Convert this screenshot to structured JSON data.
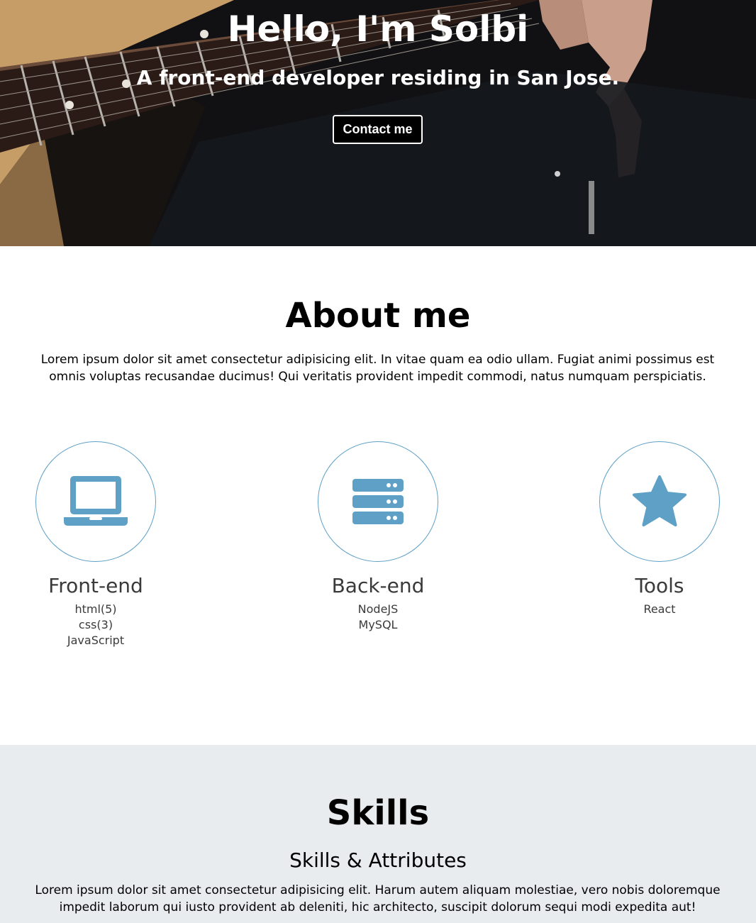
{
  "hero": {
    "title": "Hello, I'm Solbi",
    "subtitle": "A front-end developer residing in San Jose.",
    "contact_label": "Contact me"
  },
  "about": {
    "title": "About me",
    "text": "Lorem ipsum dolor sit amet consectetur adipisicing elit. In vitae quam ea odio ullam. Fugiat animi possimus est omnis voluptas recusandae ducimus! Qui veritatis provident impedit commodi, natus numquam perspiciatis.",
    "categories": [
      {
        "icon": "laptop-icon",
        "title": "Front-end",
        "items": [
          "html(5)",
          "css(3)",
          "JavaScript"
        ]
      },
      {
        "icon": "server-icon",
        "title": "Back-end",
        "items": [
          "NodeJS",
          "MySQL"
        ]
      },
      {
        "icon": "star-icon",
        "title": "Tools",
        "items": [
          "React"
        ]
      }
    ]
  },
  "skills": {
    "title": "Skills",
    "subtitle": "Skills & Attributes",
    "text": "Lorem ipsum dolor sit amet consectetur adipisicing elit. Harum autem aliquam molestiae, vero nobis doloremque impedit laborum qui iusto provident ab deleniti, hic architecto, suscipit dolorum sequi modi expedita aut!"
  },
  "colors": {
    "accent": "#5fa0c7",
    "hero_background": "#111113",
    "skills_background": "#e8ecef"
  }
}
